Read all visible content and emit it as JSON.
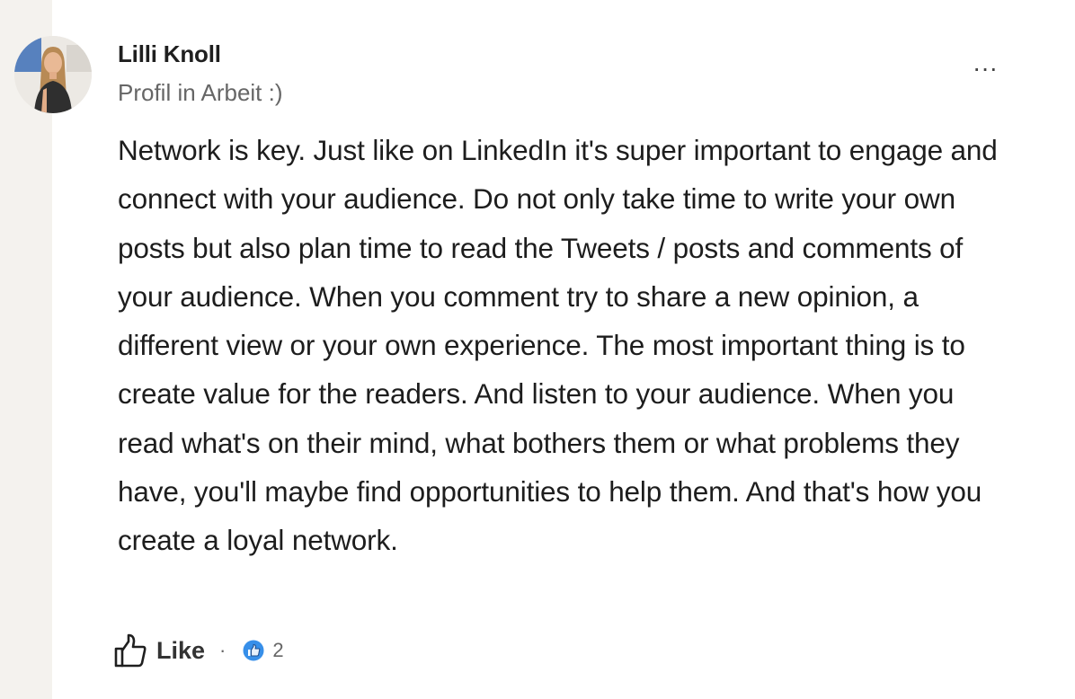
{
  "author": {
    "name": "Lilli Knoll",
    "headline": "Profil in Arbeit :)"
  },
  "comment": {
    "text": "Network is key. Just like on LinkedIn it's super important to engage and connect with your audience. Do not only take time to write your own posts but also plan time to read the Tweets / posts and comments of your audience. When you comment try to share a new opinion, a different view or your own experience. The most important thing is to create value for the readers. And listen to your audience. When you read what's on their mind, what bothers them or what problems they have, you'll maybe find opportunities to help them. And that's how you create a loyal network."
  },
  "menu": {
    "more_label": "···"
  },
  "actions": {
    "like_label": "Like",
    "separator": "·",
    "reaction_count": "2"
  },
  "icons": {
    "like": "thumbs-up-outline-icon",
    "reaction": "like-reaction-icon",
    "more": "more-horizontal-icon"
  },
  "colors": {
    "text": "#1d1d1d",
    "secondary": "#666666",
    "reaction_blue": "#378fe9",
    "strip": "#f4f2ee"
  }
}
